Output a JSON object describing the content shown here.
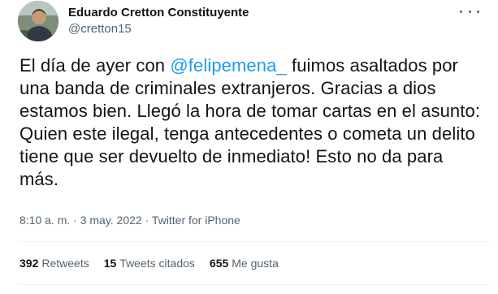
{
  "tweet": {
    "author_name": "Eduardo Cretton Constituyente",
    "author_handle": "@cretton15",
    "text_before_mention": "El día de ayer con ",
    "mention": "@felipemena_",
    "text_after_mention": " fuimos asaltados por una banda de criminales extranjeros. Gracias a dios estamos bien. Llegó la hora de tomar cartas en el asunto: Quien este ilegal, tenga antecedentes o cometa un delito tiene que ser devuelto de inmediato! Esto no da para más.",
    "timestamp": "8:10 a. m. · 3 may. 2022 · Twitter for iPhone",
    "stats": {
      "retweets_count": "392",
      "retweets_label": "Retweets",
      "quotes_count": "15",
      "quotes_label": "Tweets citados",
      "likes_count": "655",
      "likes_label": "Me gusta"
    }
  },
  "colors": {
    "accent": "#1d9bf0",
    "text": "#0f1419",
    "secondary": "#536471",
    "divider": "#eff3f4"
  },
  "icons": {
    "more": "more-options-icon"
  }
}
